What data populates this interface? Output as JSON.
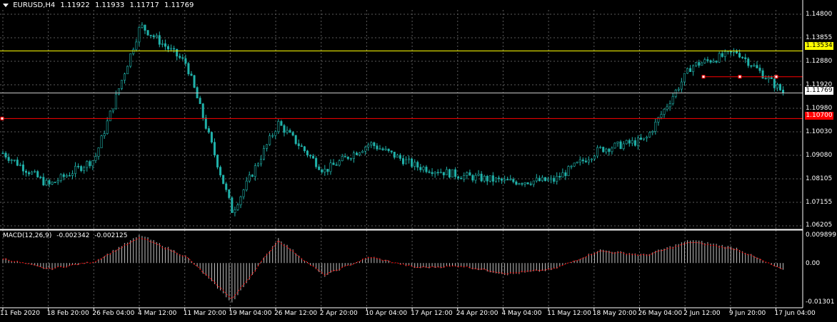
{
  "header": {
    "symbol": "EURUSD,H4",
    "open": "1.11922",
    "high": "1.11933",
    "low": "1.11717",
    "close": "1.11769"
  },
  "price_axis": [
    "1.14800",
    "1.13855",
    "1.12880",
    "1.11920",
    "1.10980",
    "1.10030",
    "1.09080",
    "1.08105",
    "1.07155",
    "1.06205"
  ],
  "price_tags": {
    "yellow_line": "1.13534",
    "current": "1.11769",
    "red_line": "1.10700"
  },
  "macd": {
    "label": "MACD(12,26,9)",
    "main": "-0.002342",
    "signal": "-0.002125",
    "axis": [
      "0.009899",
      "0.00",
      "-0.01301"
    ]
  },
  "time_axis": [
    "11 Feb 2020",
    "18 Feb 20:00",
    "26 Feb 04:00",
    "4 Mar 12:00",
    "11 Mar 20:00",
    "19 Mar 04:00",
    "26 Mar 12:00",
    "2 Apr 20:00",
    "10 Apr 04:00",
    "17 Apr 12:00",
    "24 Apr 20:00",
    "4 May 04:00",
    "11 May 12:00",
    "18 May 20:00",
    "26 May 04:00",
    "2 Jun 12:00",
    "9 Jun 20:00",
    "17 Jun 04:00"
  ],
  "colors": {
    "background": "#000000",
    "candle": "#20b2aa",
    "grid": "#5c5c5c",
    "yellow_line": "#ffff00",
    "red_line": "#ff0000",
    "macd_hist": "#c0c0c0",
    "macd_signal": "#ff0000"
  },
  "chart_data": {
    "type": "line",
    "title": "EURUSD,H4",
    "x": [
      "11 Feb 2020",
      "18 Feb 20:00",
      "26 Feb 04:00",
      "4 Mar 12:00",
      "11 Mar 20:00",
      "19 Mar 04:00",
      "26 Mar 12:00",
      "2 Apr 20:00",
      "10 Apr 04:00",
      "17 Apr 12:00",
      "24 Apr 20:00",
      "4 May 04:00",
      "11 May 12:00",
      "18 May 20:00",
      "26 May 04:00",
      "2 Jun 12:00",
      "9 Jun 20:00",
      "17 Jun 04:00"
    ],
    "series": [
      {
        "name": "EURUSD,H4",
        "values": [
          1.0925,
          1.079,
          1.09,
          1.146,
          1.13,
          1.068,
          1.105,
          1.085,
          1.0965,
          1.087,
          1.083,
          1.0805,
          1.081,
          1.094,
          1.098,
          1.129,
          1.135,
          1.118
        ]
      }
    ],
    "ylim": [
      1.0605,
      1.1525
    ],
    "horizontal_lines": [
      1.13534,
      1.107,
      1.11769
    ],
    "macd_values": [
      0.0015,
      -0.002,
      0.0005,
      0.0085,
      0.002,
      -0.012,
      0.0075,
      -0.004,
      0.002,
      -0.0015,
      -0.001,
      -0.0035,
      -0.002,
      0.004,
      0.0025,
      0.007,
      0.0045,
      -0.0023
    ],
    "macd_ylim": [
      -0.01301,
      0.009899
    ]
  }
}
